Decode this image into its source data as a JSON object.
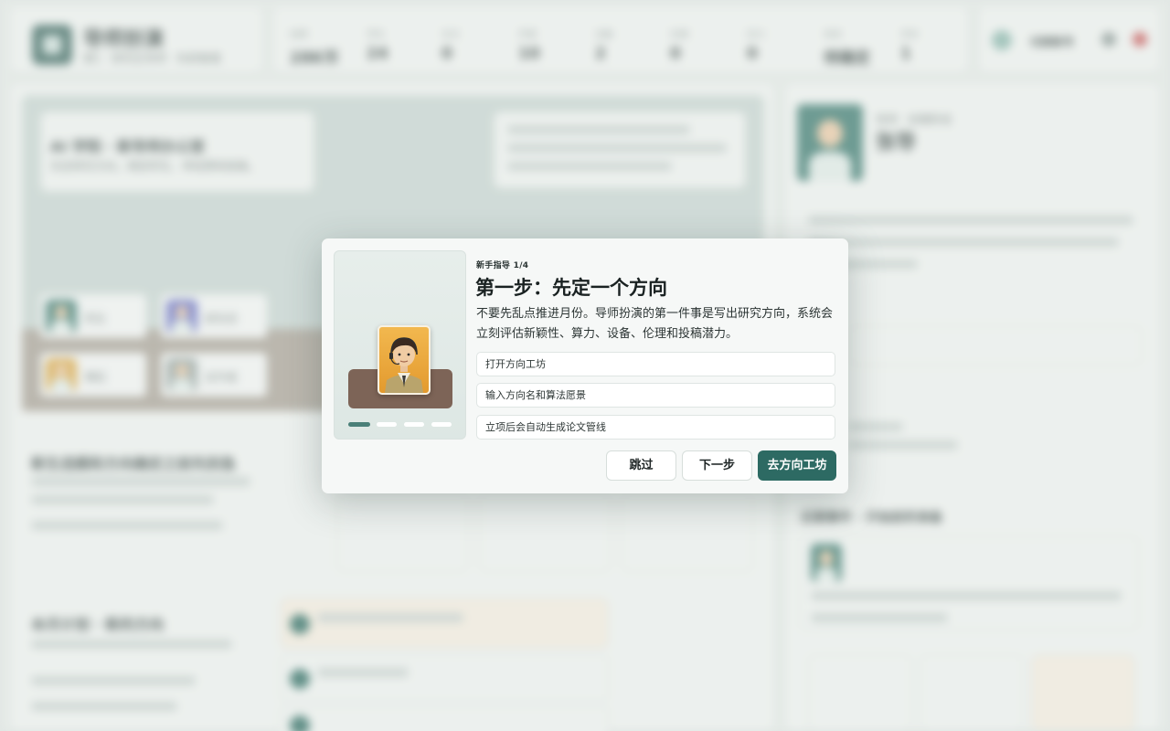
{
  "background": {
    "app_title": "导师扮演",
    "app_subtitle": "第1 · 研究生导师 · 科研管理",
    "stats": [
      {
        "label": "经费",
        "value": "28K币"
      },
      {
        "label": "学生",
        "value": "24"
      },
      {
        "label": "论文",
        "value": "0"
      },
      {
        "label": "声望",
        "value": "10"
      },
      {
        "label": "设备",
        "value": "2"
      },
      {
        "label": "伦理",
        "value": "0"
      },
      {
        "label": "压力",
        "value": "0"
      },
      {
        "label": "状态",
        "value": "待确定"
      },
      {
        "label": "月份",
        "value": "1"
      }
    ],
    "header_action": "切换账号",
    "hero_title": "AI 学院 · 新导师办公室",
    "hero_sub": "先定研究方向，再招学生、申经费和投稿。",
    "persons": [
      "学生",
      "研究员",
      "博后",
      "合作者"
    ],
    "section_title": "新生选题和方向确定之前先别急",
    "profile_name": "张导",
    "profile_tag": "导师 · 初期阶段",
    "feed_title": "近期事件 · 开始前的准备",
    "bottom_title": "本月计划 · 新的方向"
  },
  "modal": {
    "step_tag": "新手指导 1/4",
    "title": "第一步：先定一个方向",
    "description": "不要先乱点推进月份。导师扮演的第一件事是写出研究方向，系统会立刻评估新颖性、算力、设备、伦理和投稿潜力。",
    "tasks": [
      "打开方向工坊",
      "输入方向名和算法愿景",
      "立项后会自动生成论文管线"
    ],
    "buttons": {
      "skip": "跳过",
      "next": "下一步",
      "go": "去方向工坊"
    },
    "pager": {
      "total": 4,
      "current": 1
    },
    "illustration_icon": "advisor-portrait-icon"
  }
}
